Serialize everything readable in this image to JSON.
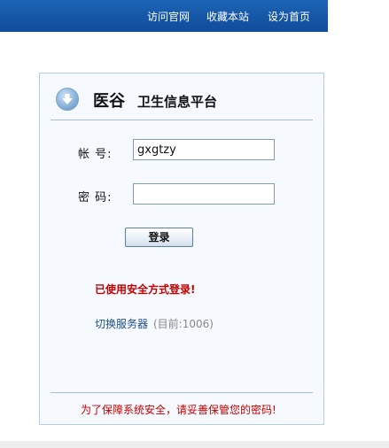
{
  "nav": {
    "links": [
      "访问官网",
      "收藏本站",
      "设为首页"
    ]
  },
  "header": {
    "brand": "医谷",
    "subtitle": "卫生信息平台",
    "icon": "down-arrow-circle-icon"
  },
  "form": {
    "username_label": "帐  号:",
    "username_value": "gxgtzy",
    "password_label": "密  码:",
    "password_value": "",
    "login_label": "登录"
  },
  "status": {
    "secure_msg": "已使用安全方式登录!",
    "switch_server": "切换服务器",
    "current_server": "(目前:1006)"
  },
  "footer": {
    "note": "为了保障系统安全，请妥善保管您的密码!"
  },
  "colors": {
    "topbar": "#0f4c99",
    "alert": "#c40000",
    "link": "#1a4f8b"
  }
}
